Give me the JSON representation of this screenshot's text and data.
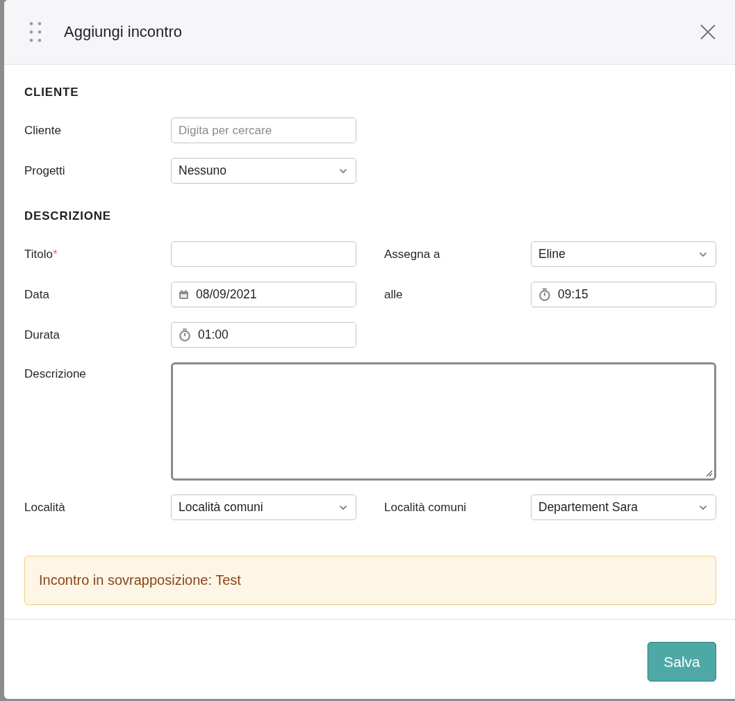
{
  "dialog": {
    "title": "Aggiungi incontro"
  },
  "sections": [
    {
      "heading": "CLIENTE",
      "rows": [
        [
          {
            "label": "Cliente",
            "kind": "text",
            "placeholder": "Digita per cercare"
          }
        ],
        [
          {
            "label": "Progetti",
            "kind": "select",
            "value": "Nessuno"
          }
        ]
      ]
    },
    {
      "heading": "DESCRIZIONE",
      "rows": [
        [
          {
            "label": "Titolo",
            "required_mark": "*",
            "kind": "text"
          },
          {
            "label": "Assegna a",
            "kind": "select",
            "value": "Eline"
          }
        ],
        [
          {
            "label": "Data",
            "kind": "date",
            "value": "08/09/2021"
          },
          {
            "label": "alle",
            "kind": "time",
            "value": "09:15"
          }
        ],
        [
          {
            "label": "Durata",
            "kind": "time",
            "value": "01:00"
          }
        ],
        [
          {
            "label": "Descrizione",
            "kind": "textarea"
          }
        ],
        [
          {
            "label": "Località",
            "kind": "select",
            "value": "Località comuni"
          },
          {
            "label": "Località comuni",
            "kind": "select",
            "value": "Departement Sara"
          }
        ]
      ]
    }
  ],
  "alert": {
    "text": "Incontro in sovrapposizione: Test"
  },
  "buttons": [
    "Salva"
  ]
}
